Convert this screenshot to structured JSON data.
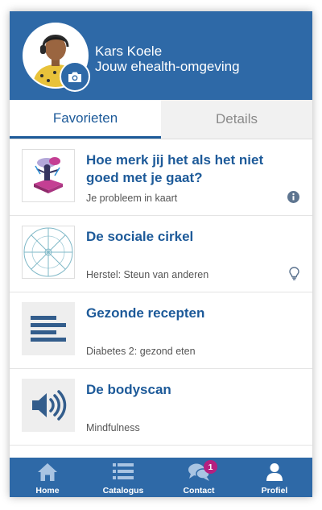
{
  "profile": {
    "name": "Kars Koele",
    "subtitle": "Jouw ehealth-omgeving"
  },
  "tabs": [
    {
      "label": "Favorieten",
      "active": true
    },
    {
      "label": "Details",
      "active": false
    }
  ],
  "items": [
    {
      "title": "Hoe merk jij het als het niet goed met je gaat?",
      "subtitle": "Je probleem in kaart",
      "icon": "info-icon"
    },
    {
      "title": "De sociale cirkel",
      "subtitle": "Herstel: Steun van anderen",
      "icon": "lightbulb-icon"
    },
    {
      "title": "Gezonde recepten",
      "subtitle": "Diabetes 2: gezond eten",
      "icon": ""
    },
    {
      "title": "De bodyscan",
      "subtitle": "Mindfulness",
      "icon": ""
    }
  ],
  "nav": [
    {
      "label": "Home",
      "icon": "home-icon"
    },
    {
      "label": "Catalogus",
      "icon": "list-icon"
    },
    {
      "label": "Contact",
      "icon": "chat-icon",
      "badge": "1"
    },
    {
      "label": "Profiel",
      "icon": "user-icon"
    }
  ],
  "colors": {
    "primary": "#2e69a7",
    "title_blue": "#1d5a99",
    "badge": "#b5207f"
  }
}
